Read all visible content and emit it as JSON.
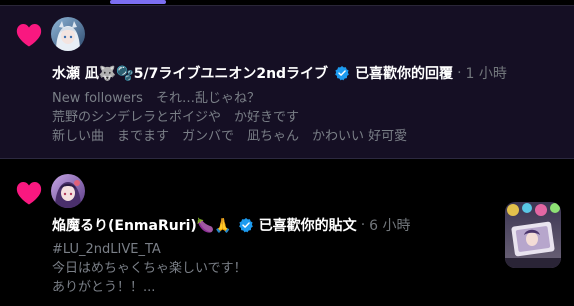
{
  "notifications": [
    {
      "icon": "heart-icon",
      "user": "水瀬 凪🐺🫧5/7ライブユニオン2ndライブ",
      "action": "已喜歡你的回覆",
      "separator": "·",
      "time": "1 小時",
      "lines": [
        "New followers　それ…乱じゃね？",
        "荒野のシンデレラとポイジや　か好きです",
        "新しい曲　までます　ガンバで　凪ちゃん　かわいい 好可愛"
      ]
    },
    {
      "icon": "heart-icon",
      "user": "焔魔るり(EnmaRuri)🍆🙏",
      "action": "已喜歡你的貼文",
      "separator": "·",
      "time": "6 小時",
      "lines": [
        "#LU_2ndLIVE_TA",
        "今日はめちゃくちゃ楽しいです！",
        "ありがとう！！..."
      ]
    }
  ],
  "colors": {
    "accent": "#7c6ef2",
    "heart": "#f91880",
    "verified": "#1d9bf0",
    "highlight_bg": "#150f24",
    "muted_text": "#71767b"
  }
}
